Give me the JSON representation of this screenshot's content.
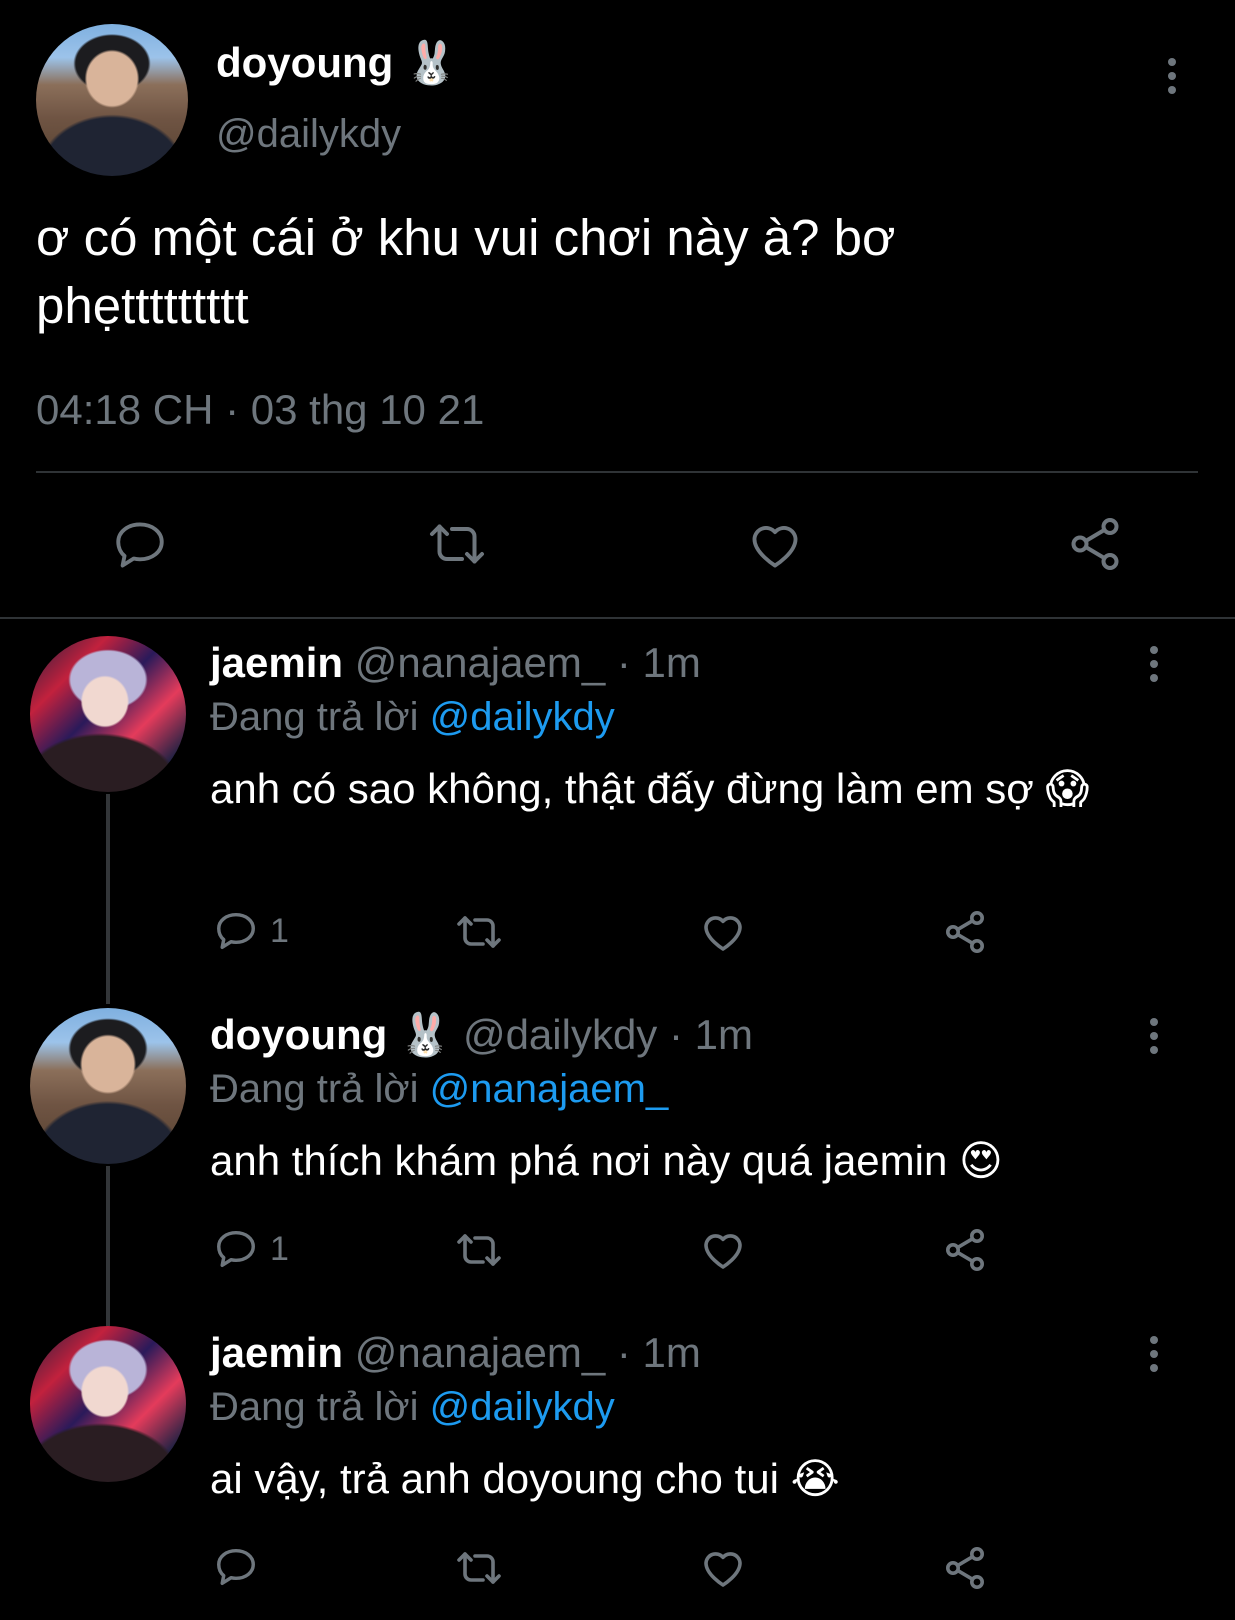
{
  "main_tweet": {
    "name": "doyoung 🐰",
    "handle": "@dailykdy",
    "text": "ơ có một cái ở khu vui chơi này à? bơ phẹttttttttt",
    "timestamp": "04:18 CH · 03 thg 10 21"
  },
  "replies": [
    {
      "name": "jaemin",
      "handle_time": "@nanajaem_ · 1m",
      "replying_prefix": "Đang trả lời",
      "replying_to": "@dailykdy",
      "text": "anh có sao không, thật đấy đừng làm em sợ 😱",
      "reply_count": "1"
    },
    {
      "name": "doyoung 🐰",
      "handle_time": "@dailykdy · 1m",
      "replying_prefix": "Đang trả lời",
      "replying_to": "@nanajaem_",
      "text": "anh thích khám phá nơi này quá jaemin 😍",
      "reply_count": "1"
    },
    {
      "name": "jaemin",
      "handle_time": "@nanajaem_ · 1m",
      "replying_prefix": "Đang trả lời",
      "replying_to": "@dailykdy",
      "text": "ai vậy, trả anh doyoung cho tui 😭",
      "reply_count": ""
    }
  ],
  "colors": {
    "background": "#000000",
    "text": "#ffffff",
    "secondary": "#6e767d",
    "link": "#1d9bf0",
    "divider": "#2f3336"
  },
  "icons": [
    "more-icon",
    "reply-icon",
    "retweet-icon",
    "like-icon",
    "share-icon"
  ]
}
